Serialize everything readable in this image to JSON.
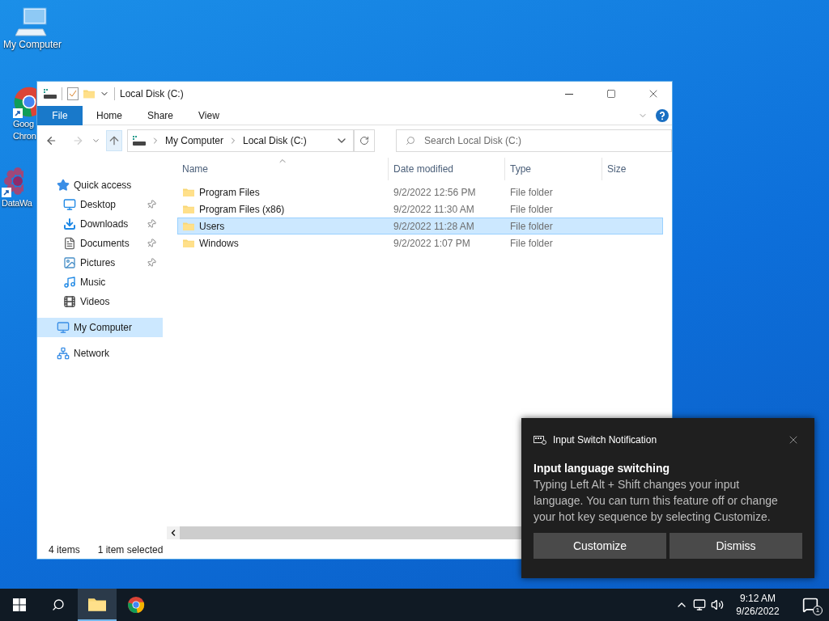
{
  "desktop_icons": [
    {
      "kind": "computer",
      "label_lines": [
        "My Computer"
      ]
    },
    {
      "kind": "chrome",
      "label_lines": [
        "Goog",
        "Chron"
      ]
    },
    {
      "kind": "datawa",
      "label_lines": [
        "DataWa"
      ]
    }
  ],
  "window": {
    "title": "Local Disk (C:)",
    "file_tab": "File",
    "ribbon_tabs": [
      "Home",
      "Share",
      "View"
    ],
    "address": {
      "crumbs": [
        "My Computer",
        "Local Disk (C:)"
      ]
    },
    "search": {
      "placeholder": "Search Local Disk (C:)"
    },
    "nav": [
      {
        "label": "Quick access",
        "kind": "star",
        "selected": false,
        "children": [
          {
            "label": "Desktop",
            "kind": "desktop",
            "pinned": true,
            "selected": false
          },
          {
            "label": "Downloads",
            "kind": "download",
            "pinned": true,
            "selected": false
          },
          {
            "label": "Documents",
            "kind": "document",
            "pinned": true,
            "selected": false
          },
          {
            "label": "Pictures",
            "kind": "pictures",
            "pinned": true,
            "selected": false
          },
          {
            "label": "Music",
            "kind": "music",
            "pinned": false,
            "selected": false
          },
          {
            "label": "Videos",
            "kind": "videos",
            "pinned": false,
            "selected": false
          }
        ]
      },
      {
        "label": "My Computer",
        "kind": "computer",
        "selected": true
      },
      {
        "label": "Network",
        "kind": "network",
        "selected": false
      }
    ],
    "columns": [
      "Name",
      "Date modified",
      "Type",
      "Size"
    ],
    "rows": [
      {
        "name": "Program Files",
        "date": "9/2/2022 12:56 PM",
        "type": "File folder",
        "selected": false
      },
      {
        "name": "Program Files (x86)",
        "date": "9/2/2022 11:30 AM",
        "type": "File folder",
        "selected": false
      },
      {
        "name": "Users",
        "date": "9/2/2022 11:28 AM",
        "type": "File folder",
        "selected": true
      },
      {
        "name": "Windows",
        "date": "9/2/2022 1:07 PM",
        "type": "File folder",
        "selected": false
      }
    ],
    "status": [
      "4 items",
      "1 item selected"
    ]
  },
  "notification": {
    "app": "Input Switch Notification",
    "title": "Input language switching",
    "body": "Typing Left Alt + Shift changes your input language. You can turn this feature off or change your hot key sequence by selecting Customize.",
    "buttons": [
      "Customize",
      "Dismiss"
    ]
  },
  "taskbar": {
    "apps": [
      {
        "kind": "explorer",
        "active": true
      },
      {
        "kind": "chrome",
        "active": false
      }
    ],
    "time": "9:12 AM",
    "date": "9/26/2022",
    "notification_count": "1"
  }
}
